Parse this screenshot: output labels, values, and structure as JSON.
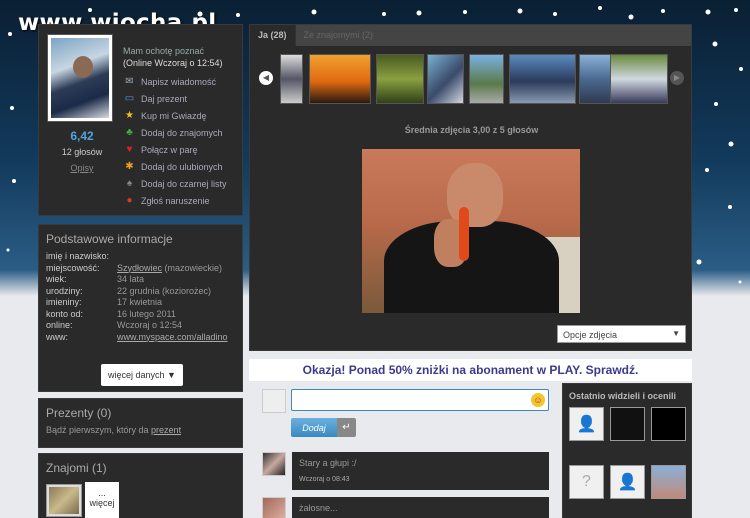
{
  "watermark": "www.wiocha.pl",
  "profile": {
    "status_line1": "Mam ochotę poznać",
    "status_line2": "(Online Wczoraj o 12:54)",
    "score": "6,42",
    "votes": "12 głosów",
    "descriptions_link": "Opisy",
    "actions": [
      {
        "label": "Napisz wiadomość",
        "icon": "envelope-icon",
        "glyph": "✉",
        "color": "#9ab"
      },
      {
        "label": "Daj prezent",
        "icon": "gift-icon",
        "glyph": "▭",
        "color": "#4a9ad8"
      },
      {
        "label": "Kup mi Gwiazdę",
        "icon": "star-icon",
        "glyph": "★",
        "color": "#f0c020"
      },
      {
        "label": "Dodaj do znajomych",
        "icon": "add-friend-icon",
        "glyph": "♣",
        "color": "#4a4"
      },
      {
        "label": "Połącz w parę",
        "icon": "heart-icon",
        "glyph": "♥",
        "color": "#e02020"
      },
      {
        "label": "Dodaj do ulubionych",
        "icon": "favorite-star-icon",
        "glyph": "✱",
        "color": "#f0a020"
      },
      {
        "label": "Dodaj do czarnej listy",
        "icon": "blacklist-icon",
        "glyph": "♠",
        "color": "#888"
      },
      {
        "label": "Zgłoś naruszenie",
        "icon": "report-icon",
        "glyph": "●",
        "color": "#d04020"
      }
    ]
  },
  "basic_info": {
    "title": "Podstawowe informacje",
    "rows": [
      {
        "key": "imię i nazwisko:",
        "value": "",
        "link": ""
      },
      {
        "key": "miejscowość:",
        "value": " (mazowieckie)",
        "link": "Szydłowiec"
      },
      {
        "key": "wiek:",
        "value": "34 lata",
        "link": ""
      },
      {
        "key": "urodziny:",
        "value": "22 grudnia (koziorożec)",
        "link": ""
      },
      {
        "key": "imieniny:",
        "value": "17 kwietnia",
        "link": ""
      },
      {
        "key": "konto od:",
        "value": "16 lutego 2011",
        "link": ""
      },
      {
        "key": "online:",
        "value": "Wczoraj o 12:54",
        "link": ""
      },
      {
        "key": "www:",
        "value": "",
        "link": "www.myspace.com/alladino"
      }
    ],
    "more_button": "więcej danych ▼"
  },
  "gifts": {
    "title": "Prezenty (0)",
    "text": "Bądź pierwszym, który da ",
    "link": "prezent"
  },
  "friends": {
    "title": "Znajomi (1)",
    "more_label": "...\nwięcej"
  },
  "photos": {
    "tab_active": "Ja (28)",
    "tab_other": "Ze znajomymi (2)",
    "average": "Średnia zdjęcia 3,00 z 5 głosów",
    "options_label": "Opcje zdjęcia"
  },
  "ad": {
    "text": "Okazja! Ponad 50% zniżki na abonament w PLAY. Sprawdź."
  },
  "comment_form": {
    "input_value": "",
    "submit_label": "Dodaj",
    "enter_glyph": "↵",
    "smiley_glyph": "☺"
  },
  "comments": [
    {
      "text": "Stary a głupi :/",
      "time": "Wczoraj o 08:43"
    },
    {
      "text": "żałosne...",
      "time": ""
    }
  ],
  "recent": {
    "title": "Ostatnio widzieli i ocenili"
  },
  "colors": {
    "accent_blue": "#3a8ac0",
    "ad_text": "#3d3a8a",
    "score": "#4fa3e0"
  }
}
